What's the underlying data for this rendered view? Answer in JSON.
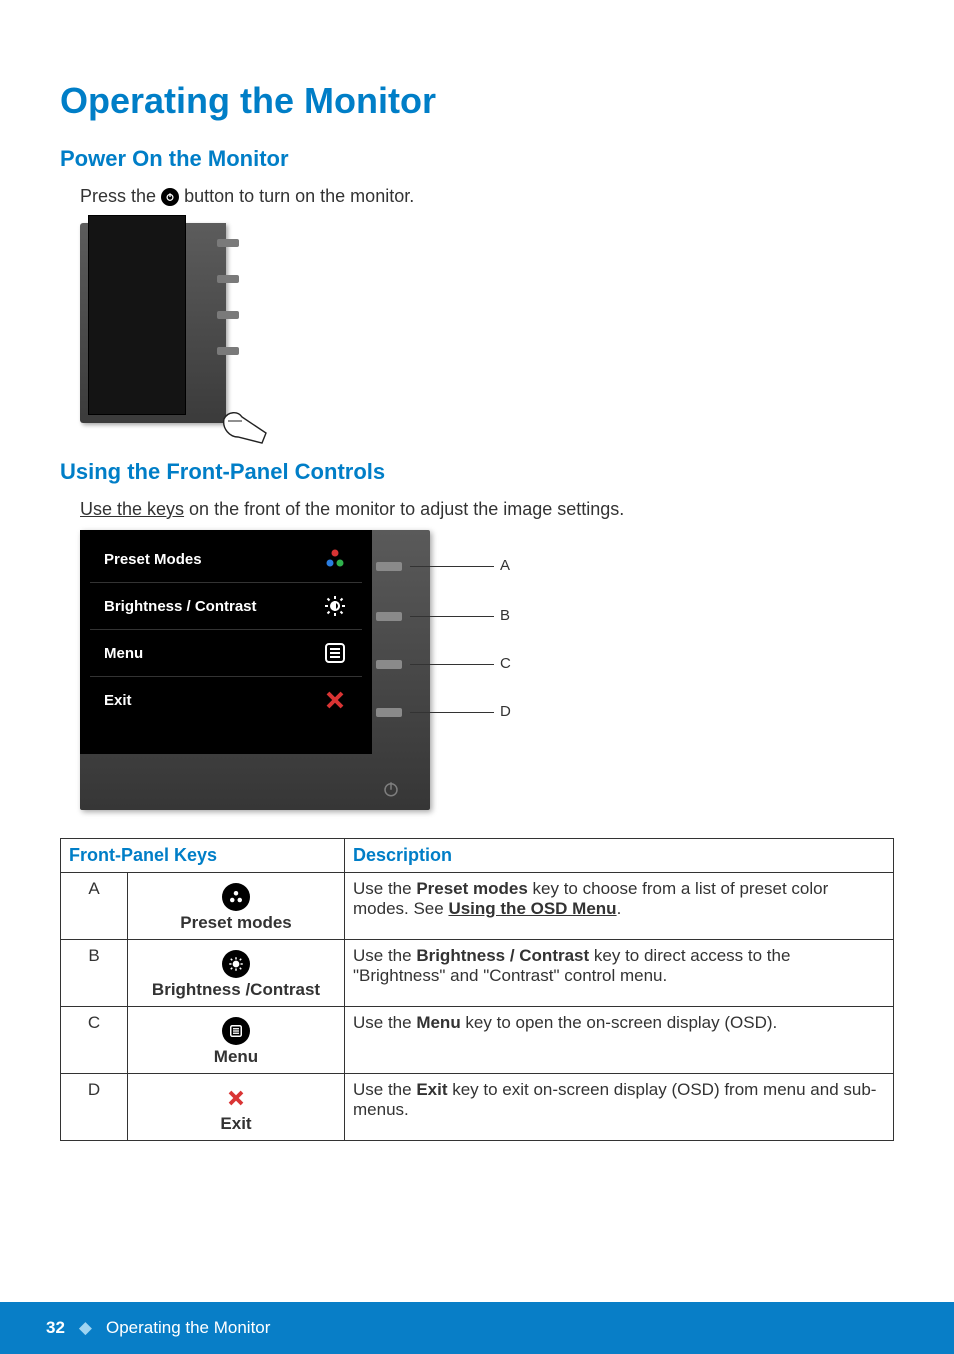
{
  "title": "Operating the Monitor",
  "sectionPower": {
    "heading": "Power On the Monitor",
    "text_before": "Press the ",
    "text_after": " button to turn on the monitor."
  },
  "sectionFP": {
    "heading": "Using the Front-Panel Controls",
    "link": "Use the keys",
    "rest": " on the front of the monitor to adjust the image settings."
  },
  "osd": {
    "preset": "Preset Modes",
    "bc": "Brightness / Contrast",
    "menu": "Menu",
    "exit": "Exit",
    "labels": {
      "a": "A",
      "b": "B",
      "c": "C",
      "d": "D"
    }
  },
  "table": {
    "h1": "Front-Panel Keys",
    "h2": "Description",
    "rows": [
      {
        "letter": "A",
        "keylabel": "Preset modes",
        "desc_pre": "Use the ",
        "desc_b": "Preset modes",
        "desc_mid": " key to choose from a list of preset color modes. See ",
        "desc_link": "Using the OSD Menu",
        "desc_end": "."
      },
      {
        "letter": "B",
        "keylabel": "Brightness /Contrast",
        "desc_pre": "Use the ",
        "desc_b": "Brightness / Contrast",
        "desc_mid": " key to direct access to the \"Brightness\" and \"Contrast\" control menu.",
        "desc_link": "",
        "desc_end": ""
      },
      {
        "letter": "C",
        "keylabel": "Menu",
        "desc_pre": "Use the ",
        "desc_b": "Menu",
        "desc_mid": " key to open the on-screen display (OSD).",
        "desc_link": "",
        "desc_end": ""
      },
      {
        "letter": "D",
        "keylabel": "Exit",
        "desc_pre": "Use the ",
        "desc_b": "Exit",
        "desc_mid": " key to exit on-screen display (OSD) from menu and sub-menus.",
        "desc_link": "",
        "desc_end": ""
      }
    ]
  },
  "footer": {
    "page": "32",
    "title": "Operating the Monitor"
  }
}
